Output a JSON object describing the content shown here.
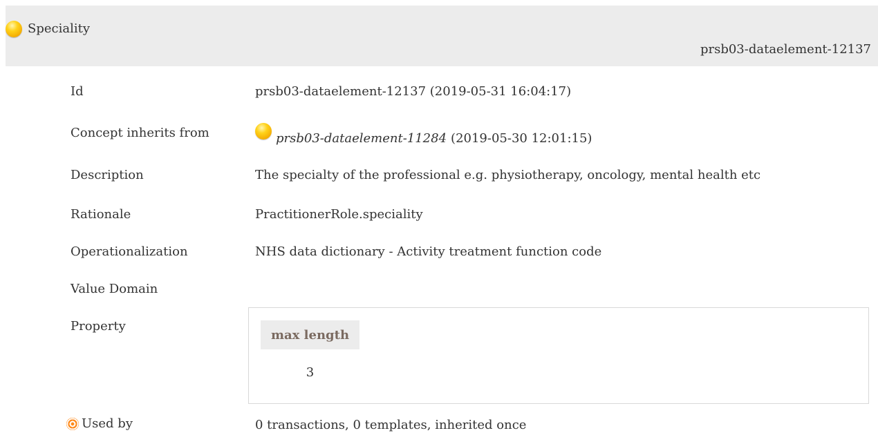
{
  "header": {
    "title": "Speciality",
    "id": "prsb03-dataelement-12137"
  },
  "fields": {
    "id": {
      "label": "Id",
      "value": "prsb03-dataelement-12137 (2019-05-31 16:04:17)"
    },
    "inherits": {
      "label": "Concept inherits from",
      "ref": "prsb03-dataelement-11284",
      "date": "(2019-05-30 12:01:15)"
    },
    "description": {
      "label": "Description",
      "value": "The specialty of the professional e.g. physiotherapy, oncology, mental health etc"
    },
    "rationale": {
      "label": "Rationale",
      "value": "PractitionerRole.speciality"
    },
    "operationalization": {
      "label": "Operationalization",
      "value": "NHS data dictionary - Activity treatment function code"
    },
    "value_domain": {
      "label": "Value Domain"
    },
    "property": {
      "label": "Property",
      "column_header": "max length",
      "column_value": "3"
    },
    "used_by": {
      "label": "Used by",
      "value": "0 transactions, 0 templates, inherited once"
    }
  },
  "icons": {
    "status_dot": "status-dot-icon",
    "used_by": "target-icon"
  },
  "colors": {
    "header_bg": "#ececec",
    "status_dot": "#ffc800",
    "property_header_text": "#7a6a60",
    "target": "#ff8a1a"
  }
}
